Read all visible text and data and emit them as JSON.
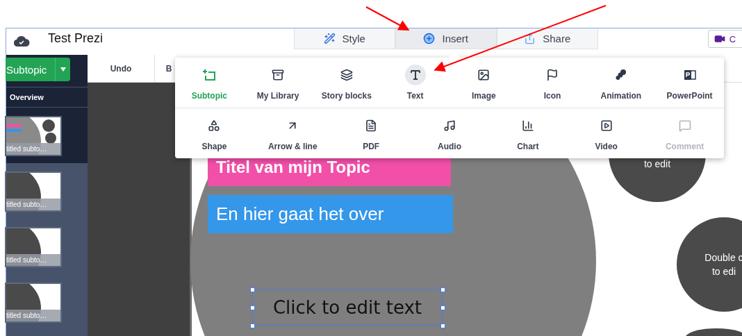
{
  "app": {
    "title": "Test Prezi"
  },
  "top_tabs": [
    {
      "label": "Style",
      "selected": false
    },
    {
      "label": "Insert",
      "selected": true
    },
    {
      "label": "Share",
      "selected": false
    }
  ],
  "record_button": {
    "label": "C"
  },
  "sidebar": {
    "add_button": "Subtopic",
    "overview": "Overview",
    "thumbnails": [
      {
        "caption": "titled subto…",
        "selected": true
      },
      {
        "caption": "titled subto…",
        "selected": false
      },
      {
        "caption": "titled subto…",
        "selected": false
      },
      {
        "caption": "titled subto…",
        "selected": false
      }
    ]
  },
  "toolbar": [
    "Undo",
    "B"
  ],
  "insert_menu": {
    "groups": [
      [
        {
          "label": "Subtopic",
          "selected": true,
          "hovered": false,
          "disabled": false
        },
        {
          "label": "My Library",
          "selected": false,
          "hovered": false,
          "disabled": false
        },
        {
          "label": "Story blocks",
          "selected": false,
          "hovered": false,
          "disabled": false
        },
        {
          "label": "Text",
          "selected": false,
          "hovered": true,
          "disabled": false
        },
        {
          "label": "Image",
          "selected": false,
          "hovered": false,
          "disabled": false
        },
        {
          "label": "Icon",
          "selected": false,
          "hovered": false,
          "disabled": false
        },
        {
          "label": "Animation",
          "selected": false,
          "hovered": false,
          "disabled": false
        },
        {
          "label": "PowerPoint",
          "selected": false,
          "hovered": false,
          "disabled": false
        }
      ],
      [
        {
          "label": "Shape",
          "selected": false,
          "hovered": false,
          "disabled": false
        },
        {
          "label": "Arrow & line",
          "selected": false,
          "hovered": false,
          "disabled": false
        },
        {
          "label": "PDF",
          "selected": false,
          "hovered": false,
          "disabled": false
        },
        {
          "label": "Audio",
          "selected": false,
          "hovered": false,
          "disabled": false
        },
        {
          "label": "Chart",
          "selected": false,
          "hovered": false,
          "disabled": false
        },
        {
          "label": "Video",
          "selected": false,
          "hovered": false,
          "disabled": false
        },
        {
          "label": "Comment",
          "selected": false,
          "hovered": false,
          "disabled": true
        }
      ]
    ]
  },
  "canvas": {
    "title_box": "Titel van mijn Topic",
    "subtitle_box": "En hier gaat het over",
    "text_box": "Click to edit text",
    "circles": [
      {
        "lines": [
          "to edit"
        ]
      },
      {
        "lines": [
          "Double c",
          "to edi"
        ]
      }
    ]
  }
}
